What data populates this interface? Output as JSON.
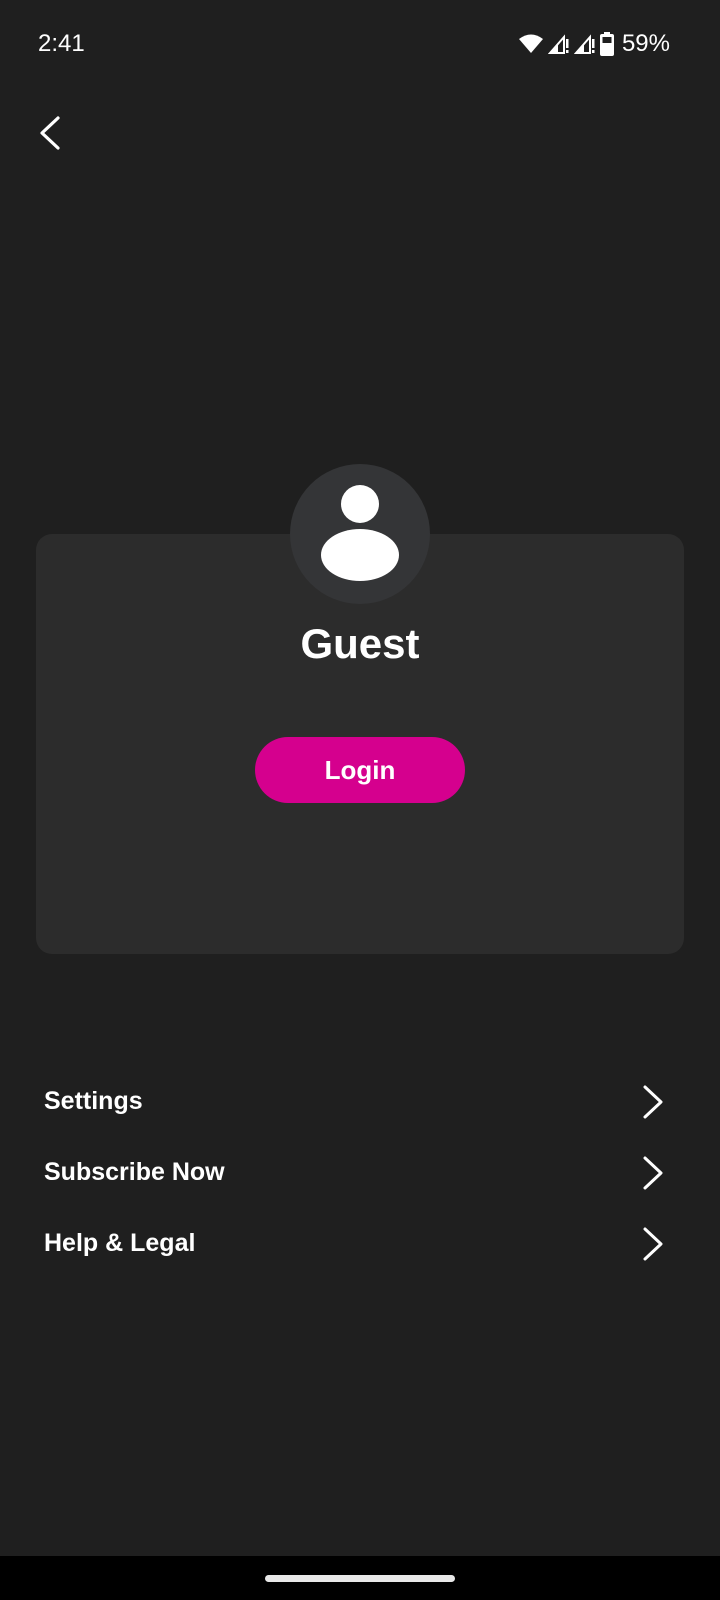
{
  "status_bar": {
    "time": "2:41",
    "battery_percent": "59%",
    "icons": [
      "wifi-icon",
      "signal-icon",
      "signal-icon",
      "battery-icon"
    ]
  },
  "header": {
    "back_icon": "chevron-left-icon"
  },
  "profile": {
    "avatar_icon": "user-avatar-icon",
    "name": "Guest",
    "login_label": "Login"
  },
  "menu": {
    "items": [
      {
        "label": "Settings",
        "icon": "chevron-right-icon"
      },
      {
        "label": "Subscribe Now",
        "icon": "chevron-right-icon"
      },
      {
        "label": "Help & Legal",
        "icon": "chevron-right-icon"
      }
    ]
  },
  "colors": {
    "background": "#1f1f1f",
    "card": "#2c2c2c",
    "accent": "#d5008e",
    "text": "#ffffff"
  }
}
